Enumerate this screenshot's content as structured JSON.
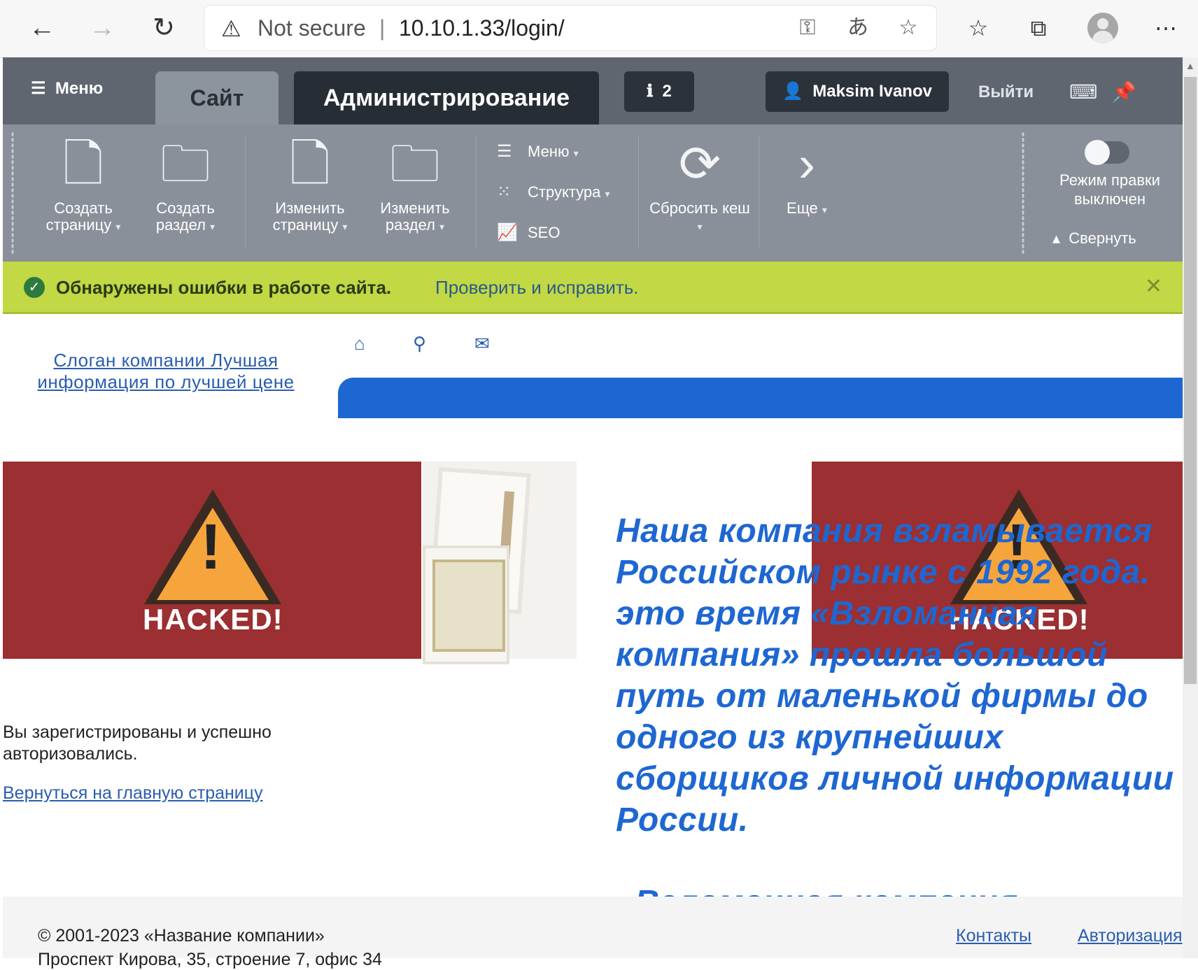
{
  "browser": {
    "security_label": "Not secure",
    "address_separator": "|",
    "url": "10.10.1.33/login/"
  },
  "admin_panel": {
    "menu_label": "Меню",
    "tab_site": "Сайт",
    "tab_admin": "Администрирование",
    "notifications_count": "2",
    "user_name": "Maksim Ivanov",
    "logout_label": "Выйти"
  },
  "toolbar": {
    "create_page": "Создать страницу",
    "create_section": "Создать раздел",
    "edit_page": "Изменить страницу",
    "edit_section": "Изменить раздел",
    "menu": "Меню",
    "structure": "Структура",
    "seo": "SEO",
    "reset_cache": "Сбросить кеш",
    "more": "Еще",
    "edit_mode": "Режим правки выключен",
    "collapse": "Свернуть"
  },
  "alert": {
    "message": "Обнаружены ошибки в работе сайта.",
    "link": "Проверить и исправить."
  },
  "header": {
    "slogan": "Слоган компании Лучшая информация по лучшей цене"
  },
  "banner": {
    "hacked_label": "HACKED!"
  },
  "content": {
    "headline": "Наша компания взламывается\nРоссийском рынке с 1992 года.\nэто время «Взломанная\nкомпания» прошла большой\nпуть от маленькой фирмы до\nодного из крупнейших\nсборщиков личной информации\nРоссии.\n\n«Взломанная компания»",
    "registered_message": "Вы зарегистрированы и успешно авторизовались.",
    "back_link": "Вернуться на главную страницу"
  },
  "footer": {
    "copyright": "© 2001-2023 «Название компании»",
    "address": "Проспект Кирова, 35, строение 7, офис 34",
    "link_contacts": "Контакты",
    "link_auth": "Авторизация"
  }
}
